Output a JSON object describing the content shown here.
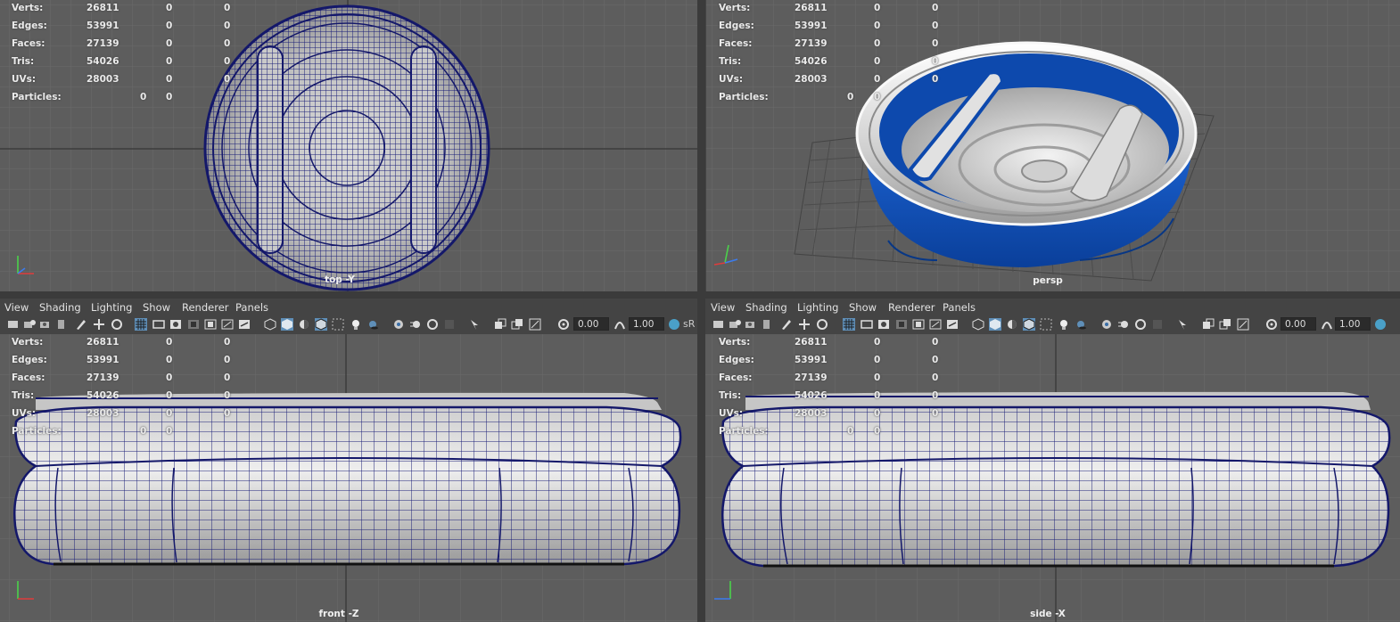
{
  "colors": {
    "viewport_bg": "#5d5d5d",
    "grid_line": "#6b6b6b",
    "grid_axis": "#3a3a3a",
    "wire": "#1b1f78",
    "accent_blue": "#1253b4",
    "menu_bg": "#444444"
  },
  "stats": {
    "labels": [
      "Verts:",
      "Edges:",
      "Faces:",
      "Tris:",
      "UVs:",
      "Particles:"
    ],
    "rows": [
      {
        "label": "Verts:",
        "a": "26811",
        "b": "0",
        "c": "0"
      },
      {
        "label": "Edges:",
        "a": "53991",
        "b": "0",
        "c": "0"
      },
      {
        "label": "Faces:",
        "a": "27139",
        "b": "0",
        "c": "0"
      },
      {
        "label": "Tris:",
        "a": "54026",
        "b": "0",
        "c": "0"
      },
      {
        "label": "UVs:",
        "a": "28003",
        "b": "0",
        "c": "0"
      },
      {
        "label": "Particles:",
        "a": "",
        "b": "0",
        "c": "0"
      }
    ]
  },
  "viewports": {
    "top": {
      "label": "top -Y"
    },
    "persp": {
      "label": "persp"
    },
    "front": {
      "label": "front -Z"
    },
    "side": {
      "label": "side -X"
    }
  },
  "panel_menu": {
    "items": [
      "View",
      "Shading",
      "Lighting",
      "Show",
      "Renderer",
      "Panels"
    ]
  },
  "toolbar": {
    "exposure_value": "0.00",
    "gamma_value": "1.00",
    "color_space_label": "sR",
    "icons": [
      "camera-select-icon",
      "camera-attributes-icon",
      "bookmark-icon",
      "image-plane-icon",
      "grease-pencil-icon",
      "2d-pan-zoom-icon",
      "grid-toggle-icon",
      "film-gate-icon",
      "resolution-gate-icon",
      "gate-mask-icon",
      "field-chart-icon",
      "safe-action-icon",
      "safe-title-icon",
      "wireframe-icon",
      "smooth-shade-icon",
      "default-material-icon",
      "wireframe-on-shaded-icon",
      "xray-icon",
      "use-all-lights-icon",
      "shadows-icon",
      "screen-space-ao-icon",
      "motion-blur-icon",
      "multisample-aa-icon",
      "depth-of-field-icon",
      "isolate-select-icon",
      "xray-joints-icon",
      "xray-active-icon",
      "backface-culling-icon",
      "exposure-icon",
      "gamma-icon",
      "color-management-icon"
    ]
  }
}
